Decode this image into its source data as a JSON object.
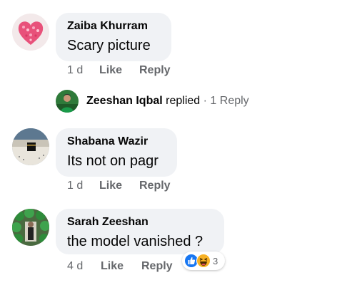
{
  "comments": [
    {
      "author": "Zaiba Khurram",
      "text": "Scary picture",
      "time": "1 d",
      "like_label": "Like",
      "reply_label": "Reply",
      "avatar_icon": "pink-heart-avatar"
    },
    {
      "author": "Shabana Wazir",
      "text": "Its not on pagr",
      "time": "1 d",
      "like_label": "Like",
      "reply_label": "Reply",
      "avatar_icon": "kaaba-photo-avatar"
    },
    {
      "author": "Sarah Zeeshan",
      "text": "the model vanished ?",
      "time": "4 d",
      "like_label": "Like",
      "reply_label": "Reply",
      "avatar_icon": "green-balloons-avatar",
      "reactions": {
        "icons": [
          "like-reaction-icon",
          "haha-reaction-icon"
        ],
        "count": "3"
      }
    }
  ],
  "reply_thread": {
    "name": "Zeeshan Iqbal",
    "verb": "replied",
    "separator": "·",
    "count_label": "1 Reply"
  },
  "colors": {
    "bubble": "#f0f2f5",
    "meta_text": "#65676b",
    "like_blue": "#1877f2",
    "haha_yellow": "#f7b125"
  }
}
